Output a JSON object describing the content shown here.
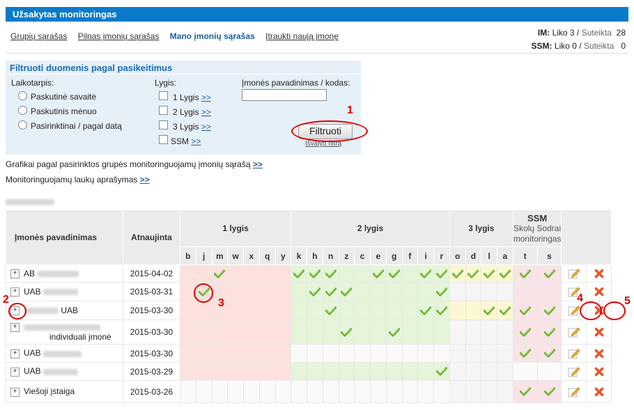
{
  "title": "Užsakytas monitoringas",
  "nav": {
    "groups": "Grupių sąrašas",
    "full": "Pilnas įmonių sąrašas",
    "mine": "Mano įmonių sąrašas",
    "add": "Įtraukti naują įmonę"
  },
  "quota": {
    "im_label": "IM:",
    "im_left": "Liko 3 /",
    "im_given": "Suteikta",
    "im_total": "28",
    "ssm_label": "SSM:",
    "ssm_left": "Liko 0 /",
    "ssm_given": "Suteikta",
    "ssm_total": "0"
  },
  "filter": {
    "title": "Filtruoti duomenis pagal pasikeitimus",
    "period_label": "Laikotarpis:",
    "period_options": [
      "Paskutinė savaitė",
      "Paskutinis mėnuo",
      "Pasirinktinai / pagal datą"
    ],
    "level_label": "Lygis:",
    "levels": [
      "1 Lygis",
      "2 Lygis",
      "3 Lygis",
      "SSM"
    ],
    "more": ">>",
    "name_label": "Įmonės pavadinimas / kodas:",
    "name_value": "",
    "button": "Filtruoti",
    "clear": "Išvalyti filtrą"
  },
  "info": {
    "charts": "Grafikai pagal pasirinktos grupės monitoringuojamų įmonių sąrašą",
    "fields": "Monitoringuojamų laukų aprašymas",
    "more": ">>"
  },
  "annotations": [
    "1",
    "2",
    "3",
    "4",
    "5"
  ],
  "table": {
    "col_name": "Įmonės pavadinimas",
    "col_updated": "Atnaujinta",
    "group1": "1 lygis",
    "group2": "2 lygis",
    "group3": "3 lygis",
    "ssm_title": "SSM",
    "ssm_sub": "Skolų Sodrai monitoringas",
    "cols": [
      "b",
      "j",
      "m",
      "w",
      "x",
      "q",
      "y",
      "k",
      "h",
      "n",
      "z",
      "c",
      "e",
      "g",
      "f",
      "i",
      "r",
      "o",
      "d",
      "l",
      "a",
      "t",
      "s"
    ],
    "rows": [
      {
        "prefix": "AB",
        "suffix": "",
        "date": "2015-04-02",
        "checks": [
          "m",
          "k",
          "h",
          "n",
          "e",
          "g",
          "i",
          "r",
          "o",
          "d",
          "l",
          "a",
          "t",
          "s"
        ]
      },
      {
        "prefix": "UAB",
        "suffix": "",
        "date": "2015-03-31",
        "checks": [
          "j",
          "h",
          "n",
          "z",
          "r"
        ]
      },
      {
        "prefix": "",
        "suffix": "UAB",
        "date": "2015-03-30",
        "checks": [
          "n",
          "i",
          "r",
          "l",
          "a",
          "t",
          "s"
        ]
      },
      {
        "prefix": "",
        "suffix": "individuali įmonė",
        "date": "2015-03-30",
        "checks": [
          "z",
          "g",
          "t",
          "s"
        ]
      },
      {
        "prefix": "UAB",
        "suffix": "",
        "date": "2015-03-30",
        "checks": [
          "t",
          "s"
        ]
      },
      {
        "prefix": "UAB",
        "suffix": "",
        "date": "2015-03-29",
        "checks": [
          "r"
        ]
      },
      {
        "prefix": "Viešoji įstaiga",
        "suffix": "",
        "date": "2015-03-26",
        "checks": [
          "t",
          "s"
        ]
      }
    ]
  }
}
